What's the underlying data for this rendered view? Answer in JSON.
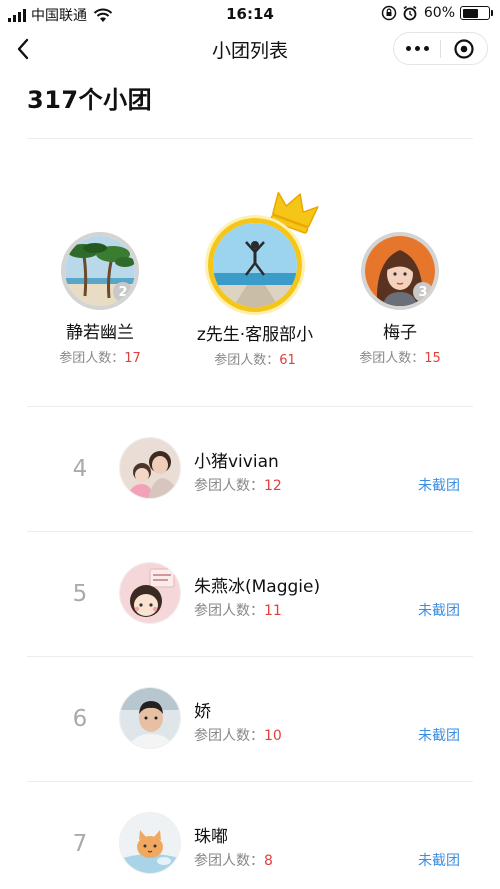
{
  "status_bar": {
    "carrier": "中国联通",
    "time": "16:14",
    "battery": "60%",
    "battery_level": 0.6
  },
  "nav": {
    "title": "小团列表"
  },
  "summary": {
    "count_title": "317个小团"
  },
  "podium": [
    {
      "rank": "2",
      "name": "静若幽兰",
      "meta_label": "参团人数：",
      "count": "17"
    },
    {
      "rank": "1",
      "name": "z先生·客服部小",
      "meta_label": "参团人数：",
      "count": "61"
    },
    {
      "rank": "3",
      "name": "梅子",
      "meta_label": "参团人数：",
      "count": "15"
    }
  ],
  "list": [
    {
      "rank": "4",
      "name": "小猪vivian",
      "meta_label": "参团人数：",
      "count": "12",
      "status": "未截团"
    },
    {
      "rank": "5",
      "name": "朱燕冰(Maggie)",
      "meta_label": "参团人数：",
      "count": "11",
      "status": "未截团"
    },
    {
      "rank": "6",
      "name": "娇",
      "meta_label": "参团人数：",
      "count": "10",
      "status": "未截团"
    },
    {
      "rank": "7",
      "name": "珠嘟",
      "meta_label": "参团人数：",
      "count": "8",
      "status": "未截团"
    }
  ],
  "colors": {
    "accent_red": "#e04040",
    "status_blue": "#3d8ee0",
    "crown_gold": "#f5c518"
  }
}
